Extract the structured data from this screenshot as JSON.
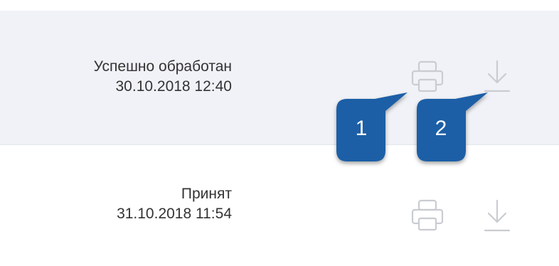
{
  "rows": [
    {
      "status": "Успешно обработан",
      "datetime": "30.10.2018 12:40"
    },
    {
      "status": "Принят",
      "datetime": "31.10.2018 11:54"
    }
  ],
  "icons": {
    "print": "printer-icon",
    "download": "download-icon"
  },
  "callouts": [
    {
      "number": "1"
    },
    {
      "number": "2"
    }
  ],
  "colors": {
    "row_highlight": "#f0f2f7",
    "icon_gray": "#c9ccd1",
    "callout_blue": "#1d5fa6"
  }
}
